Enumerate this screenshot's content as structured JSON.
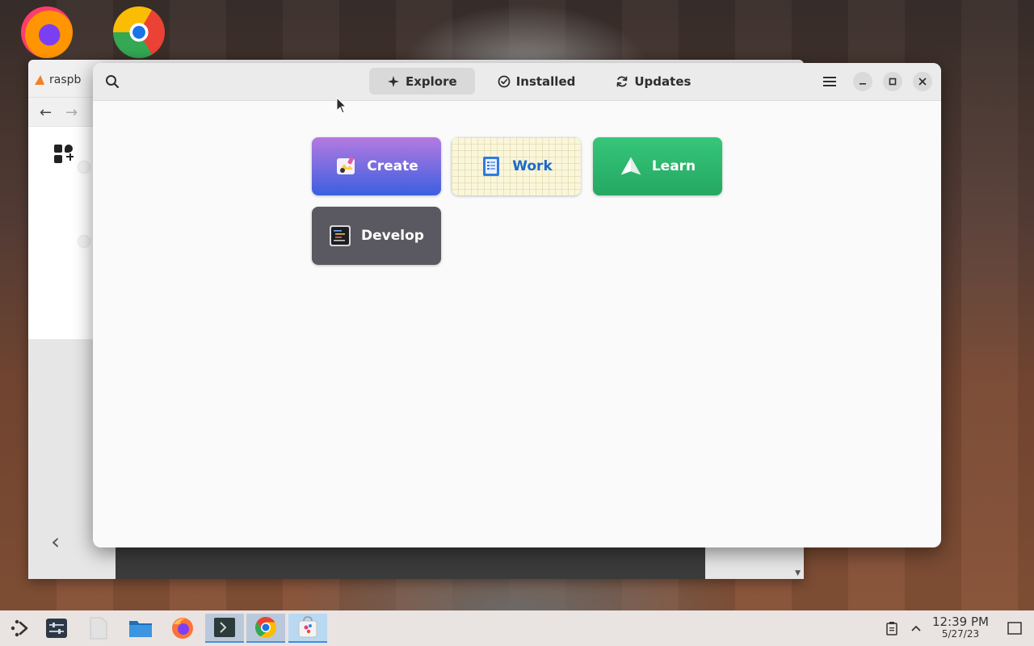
{
  "desktop": {
    "icons": [
      "firefox-icon",
      "chrome-icon"
    ]
  },
  "background_window": {
    "tab_title": "raspb"
  },
  "app": {
    "header": {
      "tabs": [
        {
          "label": "Explore",
          "icon": "sparkle-icon",
          "active": true
        },
        {
          "label": "Installed",
          "icon": "check-circle-icon",
          "active": false
        },
        {
          "label": "Updates",
          "icon": "refresh-icon",
          "active": false
        }
      ]
    },
    "categories": [
      {
        "label": "Create",
        "icon": "paint-icon"
      },
      {
        "label": "Work",
        "icon": "clipboard-icon"
      },
      {
        "label": "Learn",
        "icon": "paper-plane-icon"
      },
      {
        "label": "Develop",
        "icon": "terminal-code-icon"
      }
    ]
  },
  "taskbar": {
    "time": "12:39 PM",
    "date": "5/27/23"
  },
  "colors": {
    "create_gradient_top": "#b57ae0",
    "create_gradient_bottom": "#3b5fe0",
    "work_text": "#1b6acb",
    "learn_green": "#2fb96f",
    "develop_gray": "#5a5860",
    "taskbar_bg": "#e9e4e2"
  }
}
